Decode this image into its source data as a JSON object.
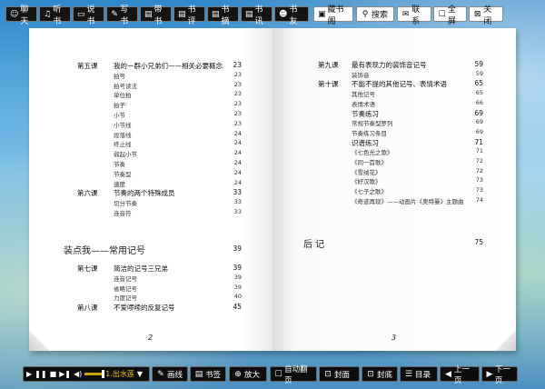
{
  "top_toolbar": [
    {
      "label": "聊天",
      "icon": "chat-icon",
      "glyph": "☺",
      "style": "dark",
      "name": "chat-button"
    },
    {
      "label": "听书",
      "icon": "headphone-icon",
      "glyph": "♫",
      "style": "dark",
      "name": "listen-button"
    },
    {
      "label": "说书",
      "icon": "tv-icon",
      "glyph": "▭",
      "style": "dark",
      "name": "talk-button"
    },
    {
      "label": "写书",
      "icon": "pen-icon",
      "glyph": "✎",
      "style": "dark",
      "name": "write-button"
    },
    {
      "label": "带书",
      "icon": "book-icon",
      "glyph": "▤",
      "style": "dark",
      "name": "carry-button"
    },
    {
      "label": "书评",
      "icon": "book-icon",
      "glyph": "▤",
      "style": "dark",
      "name": "review-button"
    },
    {
      "label": "书摘",
      "icon": "book-icon",
      "glyph": "▤",
      "style": "dark",
      "name": "excerpt-button"
    },
    {
      "label": "书讯",
      "icon": "book-icon",
      "glyph": "▤",
      "style": "dark",
      "name": "news-button"
    },
    {
      "label": "书友",
      "icon": "people-icon",
      "glyph": "☻",
      "style": "dark",
      "name": "friends-button"
    },
    {
      "label": "藏书阁",
      "icon": "library-icon",
      "glyph": "▣",
      "style": "light",
      "name": "library-button"
    },
    {
      "label": "搜索",
      "icon": "search-icon",
      "glyph": "⚲",
      "style": "light",
      "name": "search-button"
    },
    {
      "label": "联系",
      "icon": "mail-icon",
      "glyph": "✉",
      "style": "light",
      "name": "contact-button"
    },
    {
      "label": "全屏",
      "icon": "fullscreen-icon",
      "glyph": "☐",
      "style": "light",
      "name": "fullscreen-button"
    },
    {
      "label": "关闭",
      "icon": "close-icon",
      "glyph": "⊠",
      "style": "light",
      "name": "close-button"
    }
  ],
  "left_page": {
    "rows": [
      {
        "lesson": "第五课",
        "title": "我的一群小兄弟们——相关必要概念",
        "page": "23",
        "sub": false
      },
      {
        "lesson": "",
        "title": "拍号",
        "page": "23",
        "sub": true
      },
      {
        "lesson": "",
        "title": "拍号读法",
        "page": "23",
        "sub": true
      },
      {
        "lesson": "",
        "title": "单位拍",
        "page": "23",
        "sub": true
      },
      {
        "lesson": "",
        "title": "拍子",
        "page": "23",
        "sub": true
      },
      {
        "lesson": "",
        "title": "小节",
        "page": "23",
        "sub": true
      },
      {
        "lesson": "",
        "title": "小节线",
        "page": "23",
        "sub": true
      },
      {
        "lesson": "",
        "title": "段落线",
        "page": "24",
        "sub": true
      },
      {
        "lesson": "",
        "title": "终止线",
        "page": "24",
        "sub": true
      },
      {
        "lesson": "",
        "title": "弱起小节",
        "page": "24",
        "sub": true
      },
      {
        "lesson": "",
        "title": "节奏",
        "page": "24",
        "sub": true
      },
      {
        "lesson": "",
        "title": "节奏型",
        "page": "24",
        "sub": true
      },
      {
        "lesson": "",
        "title": "速度",
        "page": "24",
        "sub": true
      },
      {
        "lesson": "第六课",
        "title": "节奏的两个特殊成员",
        "page": "33",
        "sub": false
      },
      {
        "lesson": "",
        "title": "切分节奏",
        "page": "33",
        "sub": true
      },
      {
        "lesson": "",
        "title": "连音符",
        "page": "33",
        "sub": true
      }
    ],
    "part_title": "装点我——常用记号",
    "part_page": "39",
    "rows2": [
      {
        "lesson": "第七课",
        "title": "简洁的记号三兄弟",
        "page": "39",
        "sub": false
      },
      {
        "lesson": "",
        "title": "连音记号",
        "page": "39",
        "sub": true
      },
      {
        "lesson": "",
        "title": "省略记号",
        "page": "39",
        "sub": true
      },
      {
        "lesson": "",
        "title": "力度记号",
        "page": "40",
        "sub": true
      },
      {
        "lesson": "第八课",
        "title": "不爱啰嗦的反复记号",
        "page": "45",
        "sub": false
      }
    ],
    "page_number": "2"
  },
  "right_page": {
    "rows": [
      {
        "lesson": "第九课",
        "title": "最有表现力的装饰音记号",
        "page": "59",
        "sub": false
      },
      {
        "lesson": "",
        "title": "装饰音",
        "page": "59",
        "sub": true
      },
      {
        "lesson": "第十课",
        "title": "不能不提的其他记号、表情术语",
        "page": "65",
        "sub": false
      },
      {
        "lesson": "",
        "title": "其他记号",
        "page": "65",
        "sub": true
      },
      {
        "lesson": "",
        "title": "表情术语",
        "page": "66",
        "sub": true
      },
      {
        "lesson": "",
        "title": "节奏练习",
        "page": "69",
        "sub": false
      },
      {
        "lesson": "",
        "title": "常规节奏型罗列",
        "page": "69",
        "sub": true
      },
      {
        "lesson": "",
        "title": "节奏练习条目",
        "page": "69",
        "sub": true
      },
      {
        "lesson": "",
        "title": "识谱练习",
        "page": "71",
        "sub": false
      },
      {
        "lesson": "",
        "title": "《七色光之歌》",
        "page": "71",
        "sub": true
      },
      {
        "lesson": "",
        "title": "《同一首歌》",
        "page": "72",
        "sub": true
      },
      {
        "lesson": "",
        "title": "《雪绒花》",
        "page": "72",
        "sub": true
      },
      {
        "lesson": "",
        "title": "《好汉歌》",
        "page": "73",
        "sub": true
      },
      {
        "lesson": "",
        "title": "《七子之歌》",
        "page": "73",
        "sub": true
      },
      {
        "lesson": "",
        "title": "《奇迹再现》——动画片《奥特曼》主题曲",
        "page": "74",
        "sub": true
      }
    ],
    "part_title": "后  记",
    "part_page": "75",
    "page_number": "3"
  },
  "player": {
    "track": "1.出水莲"
  },
  "bottom_toolbar": [
    {
      "label": "画线",
      "icon": "pen-icon",
      "glyph": "✎",
      "name": "draw-line-button"
    },
    {
      "label": "书签",
      "icon": "bookmark-icon",
      "glyph": "▤",
      "name": "bookmark-button"
    },
    {
      "label": "放大",
      "icon": "zoom-in-icon",
      "glyph": "⊕",
      "name": "zoom-in-button"
    },
    {
      "label": "自动翻页",
      "icon": "checkbox-icon",
      "glyph": "☐",
      "name": "auto-flip-button"
    },
    {
      "label": "封面",
      "icon": "cover-icon",
      "glyph": "⊡",
      "name": "front-cover-button"
    },
    {
      "label": "封底",
      "icon": "back-cover-icon",
      "glyph": "⊡",
      "name": "back-cover-button"
    },
    {
      "label": "目录",
      "icon": "list-icon",
      "glyph": "☰",
      "name": "toc-button"
    },
    {
      "label": "上一页",
      "icon": "prev-icon",
      "glyph": "◀",
      "name": "prev-page-button"
    },
    {
      "label": "下一页",
      "icon": "next-icon",
      "glyph": "▶",
      "name": "next-page-button"
    }
  ]
}
